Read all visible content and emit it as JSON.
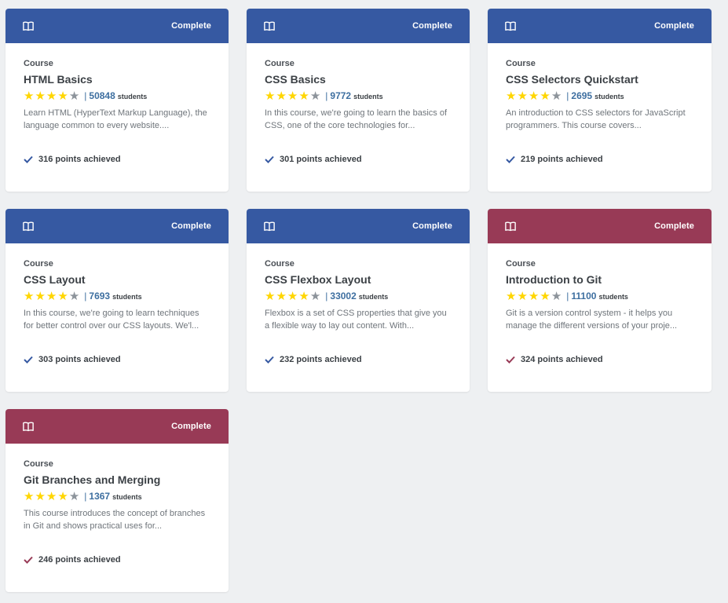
{
  "colors": {
    "blue": "#3659a2",
    "maroon": "#983a56",
    "star": "#ffd600",
    "star_off": "#8d949b"
  },
  "cards": [
    {
      "type": "Course",
      "title": "HTML Basics",
      "students_count": "50848",
      "students_label": "students",
      "description": "Learn HTML (HyperText Markup Language), the language common to every website....",
      "points": "316 points achieved",
      "status": "Complete",
      "color": "blue",
      "rating": 4
    },
    {
      "type": "Course",
      "title": "CSS Basics",
      "students_count": "9772",
      "students_label": "students",
      "description": "In this course, we're going to learn the basics of CSS, one of the core technologies for...",
      "points": "301 points achieved",
      "status": "Complete",
      "color": "blue",
      "rating": 4
    },
    {
      "type": "Course",
      "title": "CSS Selectors Quickstart",
      "students_count": "2695",
      "students_label": "students",
      "description": "An introduction to CSS selectors for JavaScript programmers. This course covers...",
      "points": "219 points achieved",
      "status": "Complete",
      "color": "blue",
      "rating": 4
    },
    {
      "type": "Course",
      "title": "CSS Layout",
      "students_count": "7693",
      "students_label": "students",
      "description": "In this course, we're going to learn techniques for better control over our CSS layouts. We'l...",
      "points": "303 points achieved",
      "status": "Complete",
      "color": "blue",
      "rating": 4
    },
    {
      "type": "Course",
      "title": "CSS Flexbox Layout",
      "students_count": "33002",
      "students_label": "students",
      "description": "Flexbox is a set of CSS properties that give you a flexible way to lay out content. With...",
      "points": "232 points achieved",
      "status": "Complete",
      "color": "blue",
      "rating": 4
    },
    {
      "type": "Course",
      "title": "Introduction to Git",
      "students_count": "11100",
      "students_label": "students",
      "description": "Git is a version control system - it helps you manage the different versions of your proje...",
      "points": "324 points achieved",
      "status": "Complete",
      "color": "maroon",
      "rating": 4
    },
    {
      "type": "Course",
      "title": "Git Branches and Merging",
      "students_count": "1367",
      "students_label": "students",
      "description": "This course introduces the concept of branches in Git and shows practical uses for...",
      "points": "246 points achieved",
      "status": "Complete",
      "color": "maroon",
      "rating": 4
    }
  ]
}
